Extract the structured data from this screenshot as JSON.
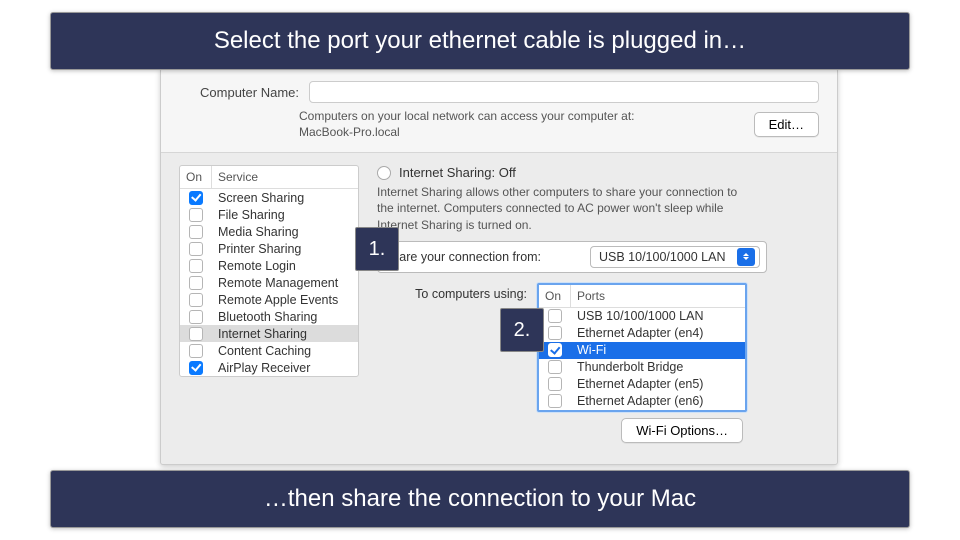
{
  "topBanner": "Select the port your ethernet cable is plugged in…",
  "bottomBanner": "…then share the connection to your Mac",
  "callout1": "1.",
  "callout2": "2.",
  "computerNameLabel": "Computer Name:",
  "computerNameValue": "",
  "accessLine1": "Computers on your local network can access your computer at:",
  "accessLine2": "MacBook-Pro.local",
  "editLabel": "Edit…",
  "serviceHeadOn": "On",
  "serviceHeadService": "Service",
  "services": [
    {
      "on": true,
      "label": "Screen Sharing",
      "selected": false
    },
    {
      "on": false,
      "label": "File Sharing",
      "selected": false
    },
    {
      "on": false,
      "label": "Media Sharing",
      "selected": false
    },
    {
      "on": false,
      "label": "Printer Sharing",
      "selected": false
    },
    {
      "on": false,
      "label": "Remote Login",
      "selected": false
    },
    {
      "on": false,
      "label": "Remote Management",
      "selected": false
    },
    {
      "on": false,
      "label": "Remote Apple Events",
      "selected": false
    },
    {
      "on": false,
      "label": "Bluetooth Sharing",
      "selected": false
    },
    {
      "on": false,
      "label": "Internet Sharing",
      "selected": true
    },
    {
      "on": false,
      "label": "Content Caching",
      "selected": false
    },
    {
      "on": true,
      "label": "AirPlay Receiver",
      "selected": false
    }
  ],
  "statusTitle": "Internet Sharing: Off",
  "statusDesc": "Internet Sharing allows other computers to share your connection to the internet. Computers connected to AC power won't sleep while Internet Sharing is turned on.",
  "shareFromLabel": "Share your connection from:",
  "shareFromValue": "USB 10/100/1000 LAN",
  "toLabel": "To computers using:",
  "portsHeadOn": "On",
  "portsHeadPorts": "Ports",
  "ports": [
    {
      "on": false,
      "label": "USB 10/100/1000 LAN",
      "selected": false
    },
    {
      "on": false,
      "label": "Ethernet Adapter (en4)",
      "selected": false
    },
    {
      "on": true,
      "label": "Wi-Fi",
      "selected": true
    },
    {
      "on": false,
      "label": "Thunderbolt Bridge",
      "selected": false
    },
    {
      "on": false,
      "label": "Ethernet Adapter (en5)",
      "selected": false
    },
    {
      "on": false,
      "label": "Ethernet Adapter (en6)",
      "selected": false
    }
  ],
  "wifiOptionsLabel": "Wi-Fi Options…"
}
